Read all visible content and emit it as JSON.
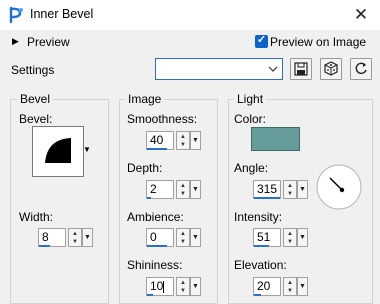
{
  "window": {
    "title": "Inner Bevel",
    "close_glyph": "✕"
  },
  "preview": {
    "toggle_glyph": "▶",
    "label": "Preview",
    "preview_on_image_label": "Preview on Image",
    "preview_on_image_checked": true
  },
  "settings": {
    "label": "Settings",
    "value": ""
  },
  "bevel": {
    "group_title": "Bevel",
    "bevel_label": "Bevel:",
    "width_label": "Width:",
    "width_value": "8"
  },
  "image": {
    "group_title": "Image",
    "smoothness_label": "Smoothness:",
    "smoothness_value": "40",
    "depth_label": "Depth:",
    "depth_value": "2",
    "ambience_label": "Ambience:",
    "ambience_value": "0",
    "shininess_label": "Shininess:",
    "shininess_value": "10"
  },
  "light": {
    "group_title": "Light",
    "color_label": "Color:",
    "color_value": "#669d9b",
    "angle_label": "Angle:",
    "angle_value": "315",
    "intensity_label": "Intensity:",
    "intensity_value": "51",
    "elevation_label": "Elevation:",
    "elevation_value": "20"
  },
  "icons": {
    "app": "paintshop-icon",
    "save": "save-preset-icon",
    "randomize": "dice-icon",
    "reset": "reset-icon"
  }
}
